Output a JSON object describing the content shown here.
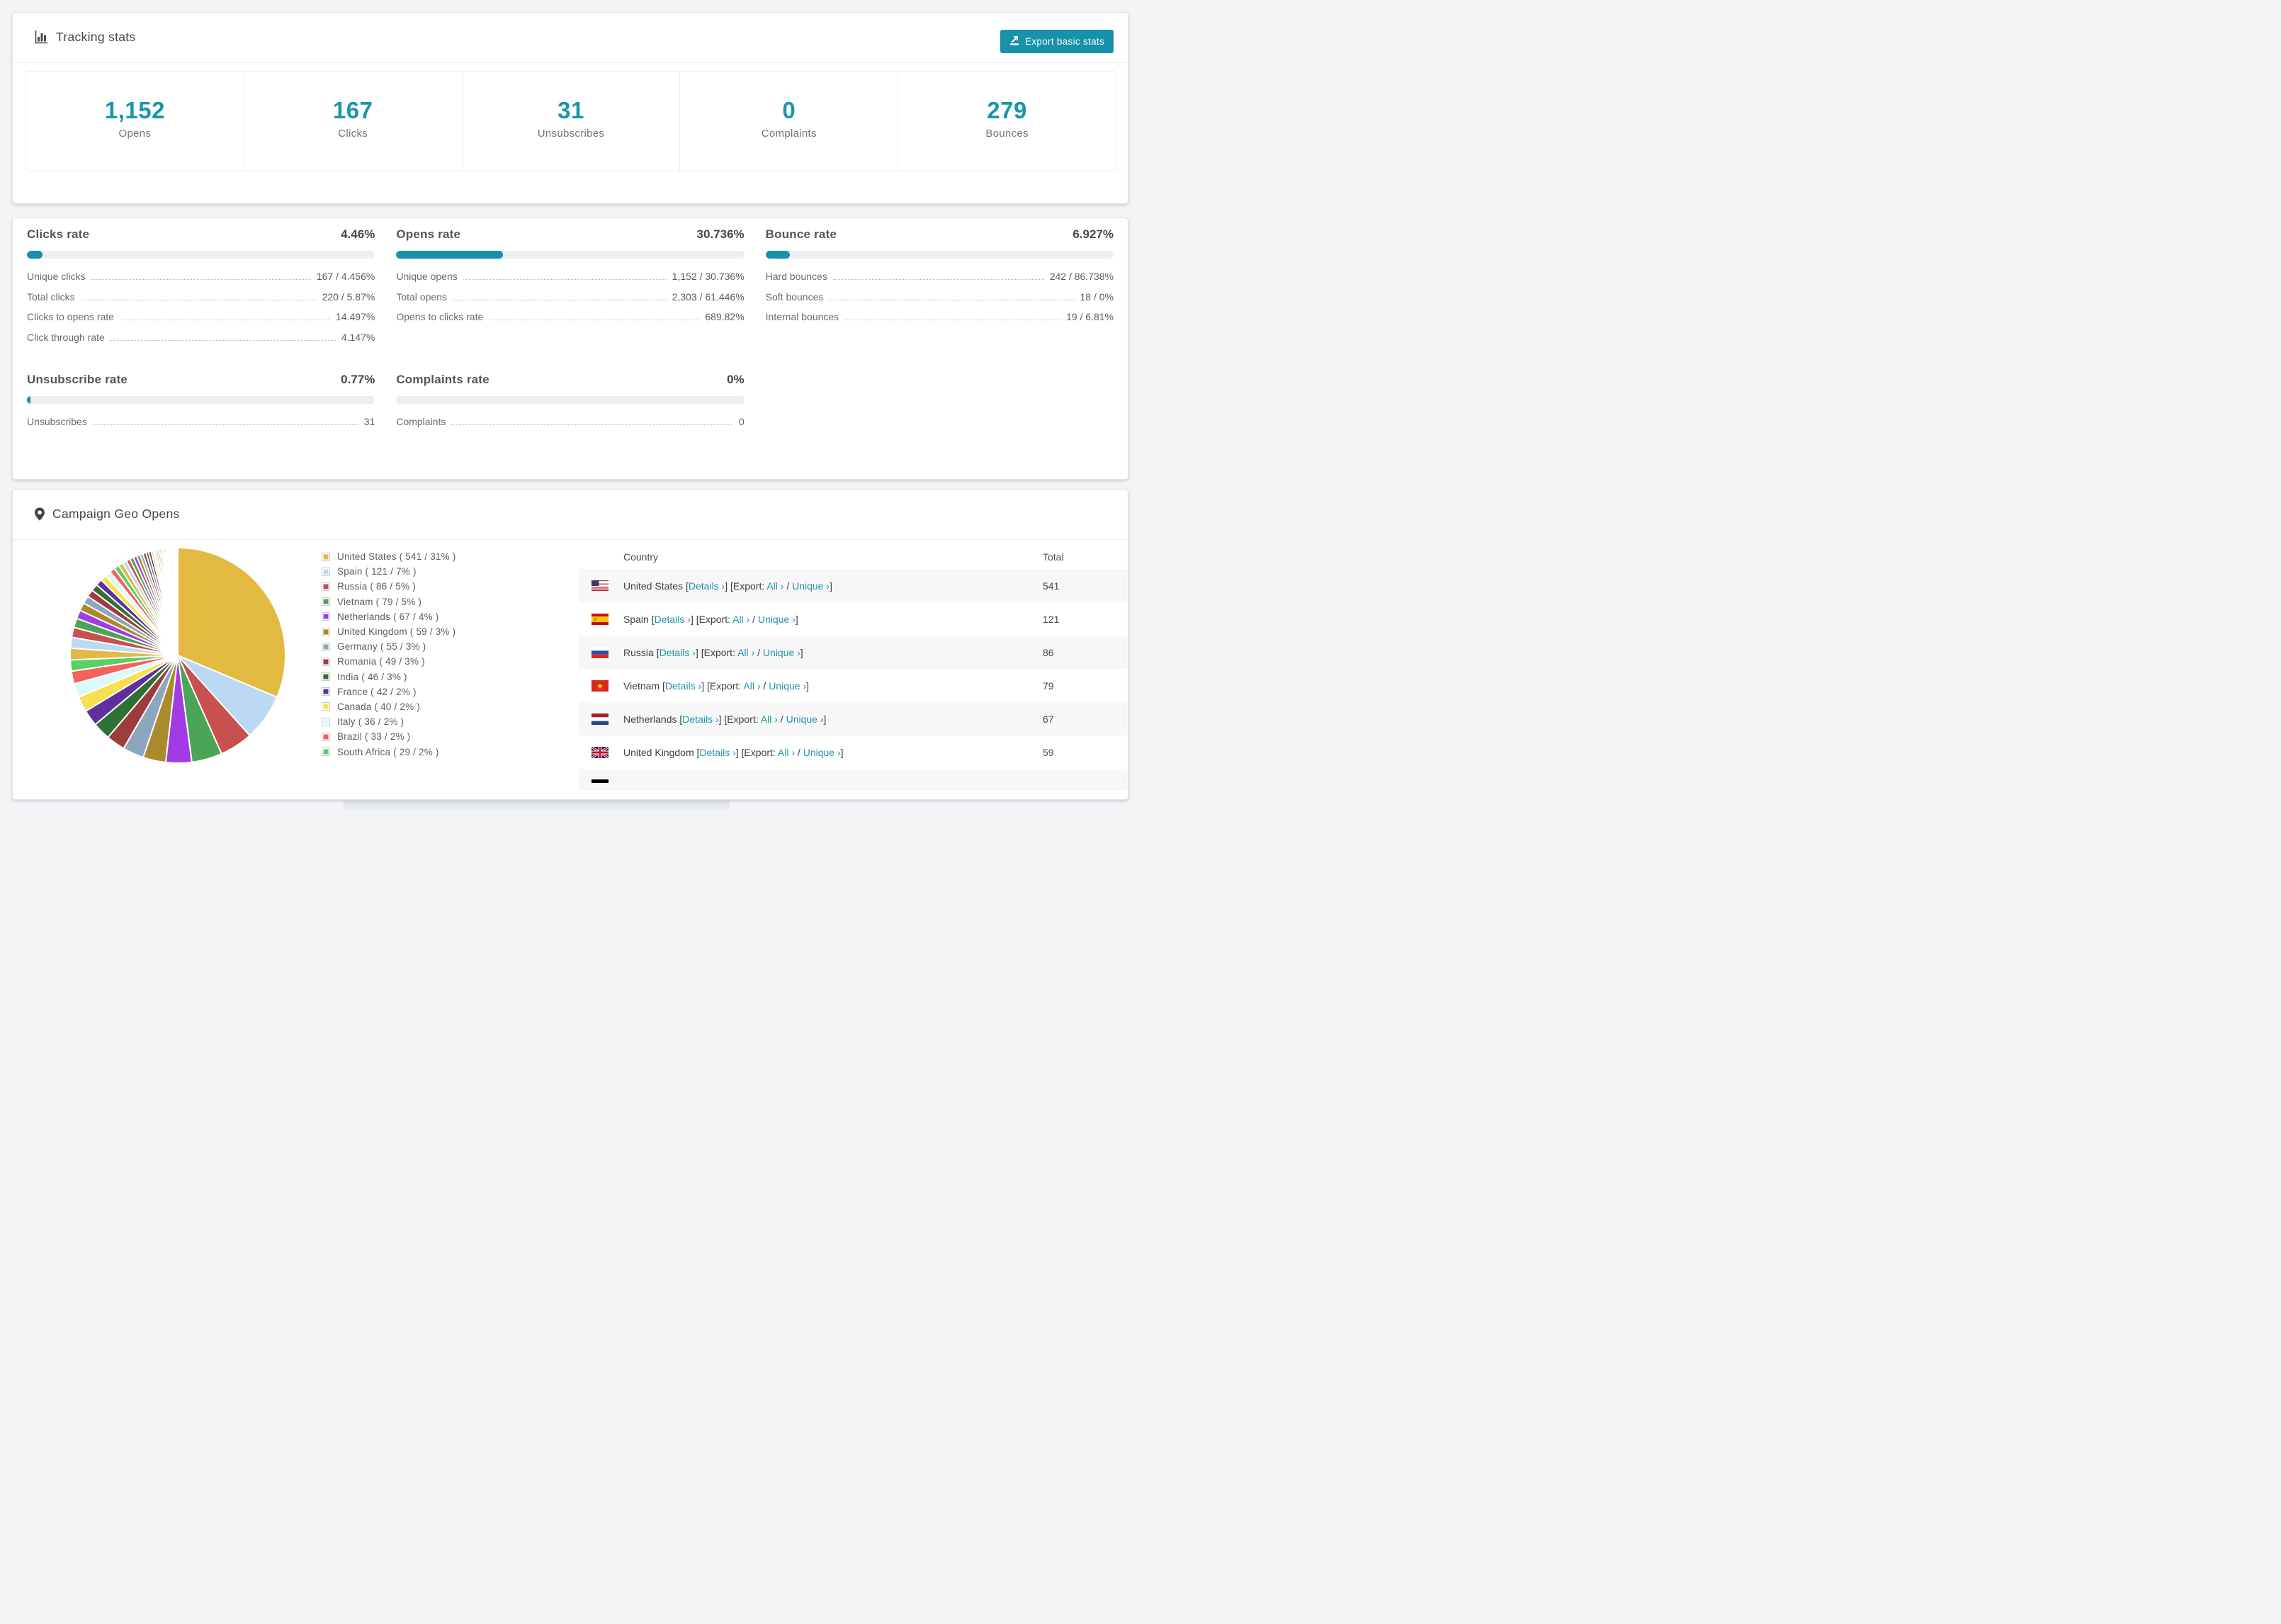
{
  "accent": "#1792aa",
  "tracking": {
    "title": "Tracking stats",
    "export_label": "Export basic stats",
    "stats": [
      {
        "value": "1,152",
        "label": "Opens"
      },
      {
        "value": "167",
        "label": "Clicks"
      },
      {
        "value": "31",
        "label": "Unsubscribes"
      },
      {
        "value": "0",
        "label": "Complaints"
      },
      {
        "value": "279",
        "label": "Bounces"
      }
    ]
  },
  "rates": [
    {
      "title": "Clicks rate",
      "pct_label": "4.46%",
      "pct": 4.46,
      "rows": [
        {
          "label": "Unique clicks",
          "value": "167 / 4.456%"
        },
        {
          "label": "Total clicks",
          "value": "220 / 5.87%"
        },
        {
          "label": "Clicks to opens rate",
          "value": "14.497%"
        },
        {
          "label": "Click through rate",
          "value": "4.147%"
        }
      ]
    },
    {
      "title": "Opens rate",
      "pct_label": "30.736%",
      "pct": 30.736,
      "rows": [
        {
          "label": "Unique opens",
          "value": "1,152 / 30.736%"
        },
        {
          "label": "Total opens",
          "value": "2,303 / 61.446%"
        },
        {
          "label": "Opens to clicks rate",
          "value": "689.82%"
        }
      ]
    },
    {
      "title": "Bounce rate",
      "pct_label": "6.927%",
      "pct": 6.927,
      "rows": [
        {
          "label": "Hard bounces",
          "value": "242 / 86.738%"
        },
        {
          "label": "Soft bounces",
          "value": "18 / 0%"
        },
        {
          "label": "Internal bounces",
          "value": "19 / 6.81%"
        }
      ]
    },
    {
      "title": "Unsubscribe rate",
      "pct_label": "0.77%",
      "pct": 0.77,
      "rows": [
        {
          "label": "Unsubscribes",
          "value": "31"
        }
      ]
    },
    {
      "title": "Complaints rate",
      "pct_label": "0%",
      "pct": 0,
      "rows": [
        {
          "label": "Complaints",
          "value": "0"
        }
      ]
    }
  ],
  "geo": {
    "title": "Campaign Geo Opens",
    "chart_data": {
      "type": "pie",
      "title": "Campaign Geo Opens",
      "labels": [
        "United States",
        "Spain",
        "Russia",
        "Vietnam",
        "Netherlands",
        "United Kingdom",
        "Germany",
        "Romania",
        "India",
        "France",
        "Canada",
        "Italy",
        "Brazil",
        "South Africa"
      ],
      "values": [
        541,
        121,
        86,
        79,
        67,
        59,
        55,
        49,
        46,
        42,
        40,
        36,
        33,
        29
      ],
      "colors": [
        "#e2ba41",
        "#bcd9f3",
        "#c8504e",
        "#4aa556",
        "#a03be5",
        "#ab8a2c",
        "#8ba6bd",
        "#9c3c3c",
        "#2e7135",
        "#5f2f9c",
        "#f6e14d",
        "#dbfaf6",
        "#f4615f",
        "#57d065"
      ],
      "others_estimated": [
        30,
        28,
        26,
        24,
        22,
        21,
        20,
        19,
        18,
        17,
        16,
        15,
        14,
        13,
        12,
        11,
        10,
        10,
        9,
        9,
        8,
        8,
        7,
        7,
        6,
        6,
        5,
        5,
        5,
        4,
        4,
        4,
        3,
        3,
        3,
        3,
        2,
        2,
        2,
        2,
        2,
        2,
        1,
        1,
        1,
        1,
        1,
        1
      ],
      "legend_position": "right",
      "start_angle_deg": 0,
      "direction": "clockwise"
    },
    "legend": [
      {
        "label": "United States ( 541 / 31% )",
        "color": "#e2ba41"
      },
      {
        "label": "Spain ( 121 / 7% )",
        "color": "#bcd9f3"
      },
      {
        "label": "Russia ( 86 / 5% )",
        "color": "#c8504e"
      },
      {
        "label": "Vietnam ( 79 / 5% )",
        "color": "#4aa556"
      },
      {
        "label": "Netherlands ( 67 / 4% )",
        "color": "#a03be5"
      },
      {
        "label": "United Kingdom ( 59 / 3% )",
        "color": "#ab8a2c"
      },
      {
        "label": "Germany ( 55 / 3% )",
        "color": "#8ba6bd"
      },
      {
        "label": "Romania ( 49 / 3% )",
        "color": "#9c3c3c"
      },
      {
        "label": "India ( 46 / 3% )",
        "color": "#2e7135"
      },
      {
        "label": "France ( 42 / 2% )",
        "color": "#5f2f9c"
      },
      {
        "label": "Canada ( 40 / 2% )",
        "color": "#f6e14d"
      },
      {
        "label": "Italy ( 36 / 2% )",
        "color": "#dbfaf6"
      },
      {
        "label": "Brazil ( 33 / 2% )",
        "color": "#f4615f"
      },
      {
        "label": "South Africa ( 29 / 2% )",
        "color": "#57d065"
      }
    ],
    "table": {
      "headers": [
        "Country",
        "Total"
      ],
      "link_details": "Details ›",
      "export_word": "Export:",
      "link_all": "All ›",
      "link_unique": "Unique ›",
      "rows": [
        {
          "country": "United States",
          "flag": "us",
          "total": "541"
        },
        {
          "country": "Spain",
          "flag": "es",
          "total": "121"
        },
        {
          "country": "Russia",
          "flag": "ru",
          "total": "86"
        },
        {
          "country": "Vietnam",
          "flag": "vn",
          "total": "79"
        },
        {
          "country": "Netherlands",
          "flag": "nl",
          "total": "67"
        },
        {
          "country": "United Kingdom",
          "flag": "gb",
          "total": "59"
        },
        {
          "partial": true
        }
      ]
    }
  }
}
